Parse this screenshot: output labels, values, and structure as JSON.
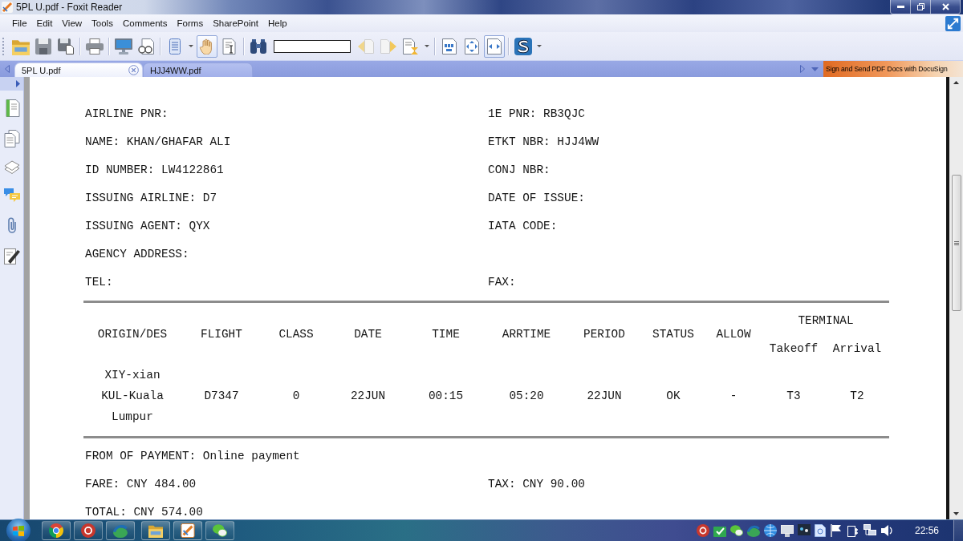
{
  "window": {
    "title": "5PL U.pdf - Foxit Reader"
  },
  "menu": [
    "File",
    "Edit",
    "View",
    "Tools",
    "Comments",
    "Forms",
    "SharePoint",
    "Help"
  ],
  "toolbar": {
    "tools": [
      {
        "kind": "hand",
        "selected": true
      },
      {
        "kind": "select",
        "selected": false
      }
    ],
    "zoom_modes": [
      {
        "kind": "actual",
        "selected": false
      },
      {
        "kind": "page",
        "selected": false
      },
      {
        "kind": "width",
        "selected": true
      }
    ]
  },
  "tabs": [
    {
      "label": "5PL U.pdf",
      "selected": true
    },
    {
      "label": "HJJ4WW.pdf",
      "selected": false
    }
  ],
  "banner": {
    "text": "Sign and Send PDF Docs with DocuSign"
  },
  "document": {
    "info_rows": [
      {
        "left": "AIRLINE PNR:",
        "right": "1E PNR: RB3QJC"
      },
      {
        "left": "NAME: KHAN/GHAFAR ALI",
        "right": "ETKT NBR: HJJ4WW"
      },
      {
        "left": "ID NUMBER: LW4122861",
        "right": "CONJ NBR:"
      },
      {
        "left": "ISSUING AIRLINE: D7",
        "right": "DATE OF ISSUE:"
      },
      {
        "left": "ISSUING AGENT: QYX",
        "right": "IATA CODE:"
      },
      {
        "left": "AGENCY ADDRESS:"
      },
      {
        "left": "TEL:",
        "right": "FAX:"
      }
    ],
    "itinerary": {
      "columns": [
        "ORIGIN/DES",
        "FLIGHT",
        "CLASS",
        "DATE",
        "TIME",
        "ARRTIME",
        "PERIOD",
        "STATUS",
        "ALLOW"
      ],
      "column_group": {
        "label": "TERMINAL",
        "columns": [
          "Takeoff",
          "Arrival"
        ]
      },
      "rows": [
        {
          "cells": [
            "XIY-xian\nKUL-Kuala\nLumpur",
            "D7347",
            "0",
            "22JUN",
            "00:15",
            "05:20",
            "22JUN",
            "OK",
            "-",
            "T3",
            "T2"
          ]
        }
      ]
    },
    "payment_rows": [
      {
        "left": "FROM OF PAYMENT: Online payment"
      },
      {
        "left": "FARE: CNY 484.00",
        "right": "TAX: CNY 90.00"
      },
      {
        "left": "TOTAL: CNY 574.00"
      }
    ]
  },
  "taskbar": {
    "clock": "22:56"
  }
}
